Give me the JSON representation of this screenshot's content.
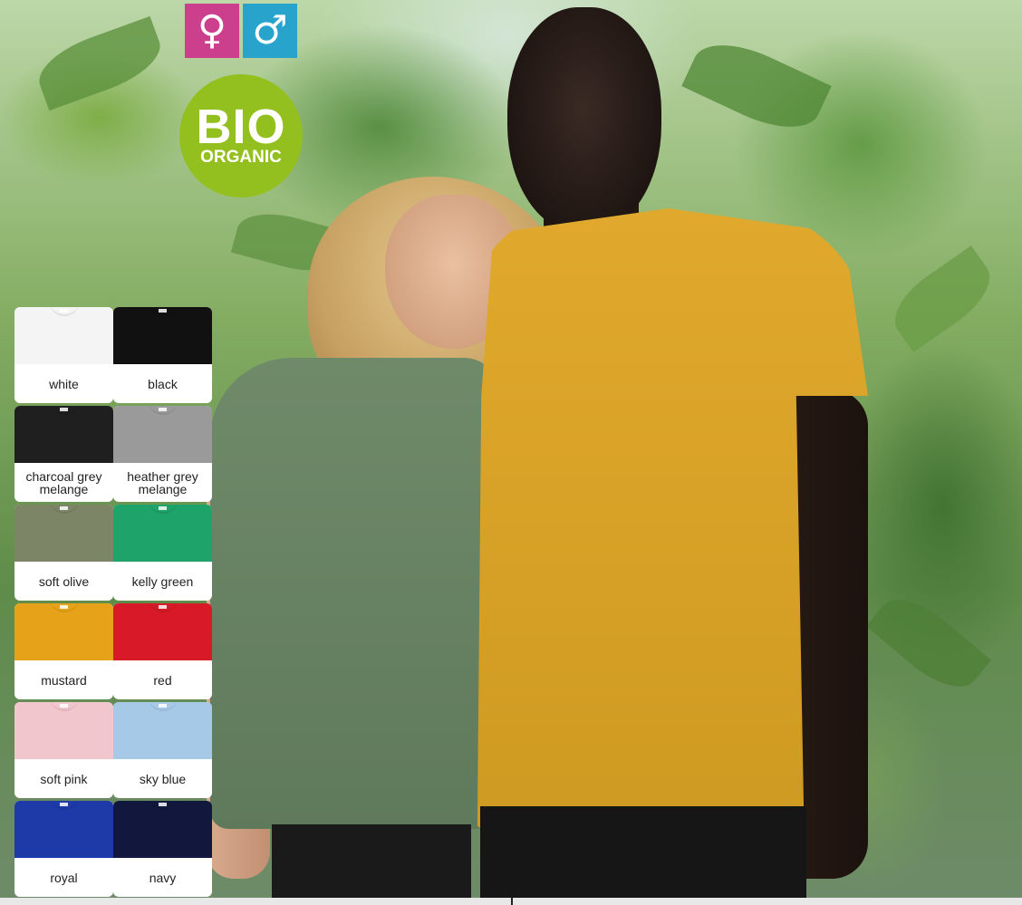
{
  "symbols": {
    "female": "♀",
    "male": "♂"
  },
  "badge": {
    "line1": "BIO",
    "line2": "ORGANIC",
    "color": "#93c01f"
  },
  "colors": {
    "female_symbol_bg": "#cc3f8c",
    "male_symbol_bg": "#27a3cc"
  },
  "swatches": [
    {
      "label": "white",
      "color": "#f4f4f4"
    },
    {
      "label": "black",
      "color": "#111111"
    },
    {
      "label": "charcoal grey melange",
      "color": "#1f1f1f"
    },
    {
      "label": "heather grey melange",
      "color": "#9a9a9a"
    },
    {
      "label": "soft olive",
      "color": "#7c8566"
    },
    {
      "label": "kelly green",
      "color": "#1ea36a"
    },
    {
      "label": "mustard",
      "color": "#e6a31a"
    },
    {
      "label": "red",
      "color": "#d71928"
    },
    {
      "label": "soft pink",
      "color": "#f1c6cc"
    },
    {
      "label": "sky blue",
      "color": "#a6c9e8"
    },
    {
      "label": "royal",
      "color": "#1e3aa8"
    },
    {
      "label": "navy",
      "color": "#12183d"
    }
  ]
}
